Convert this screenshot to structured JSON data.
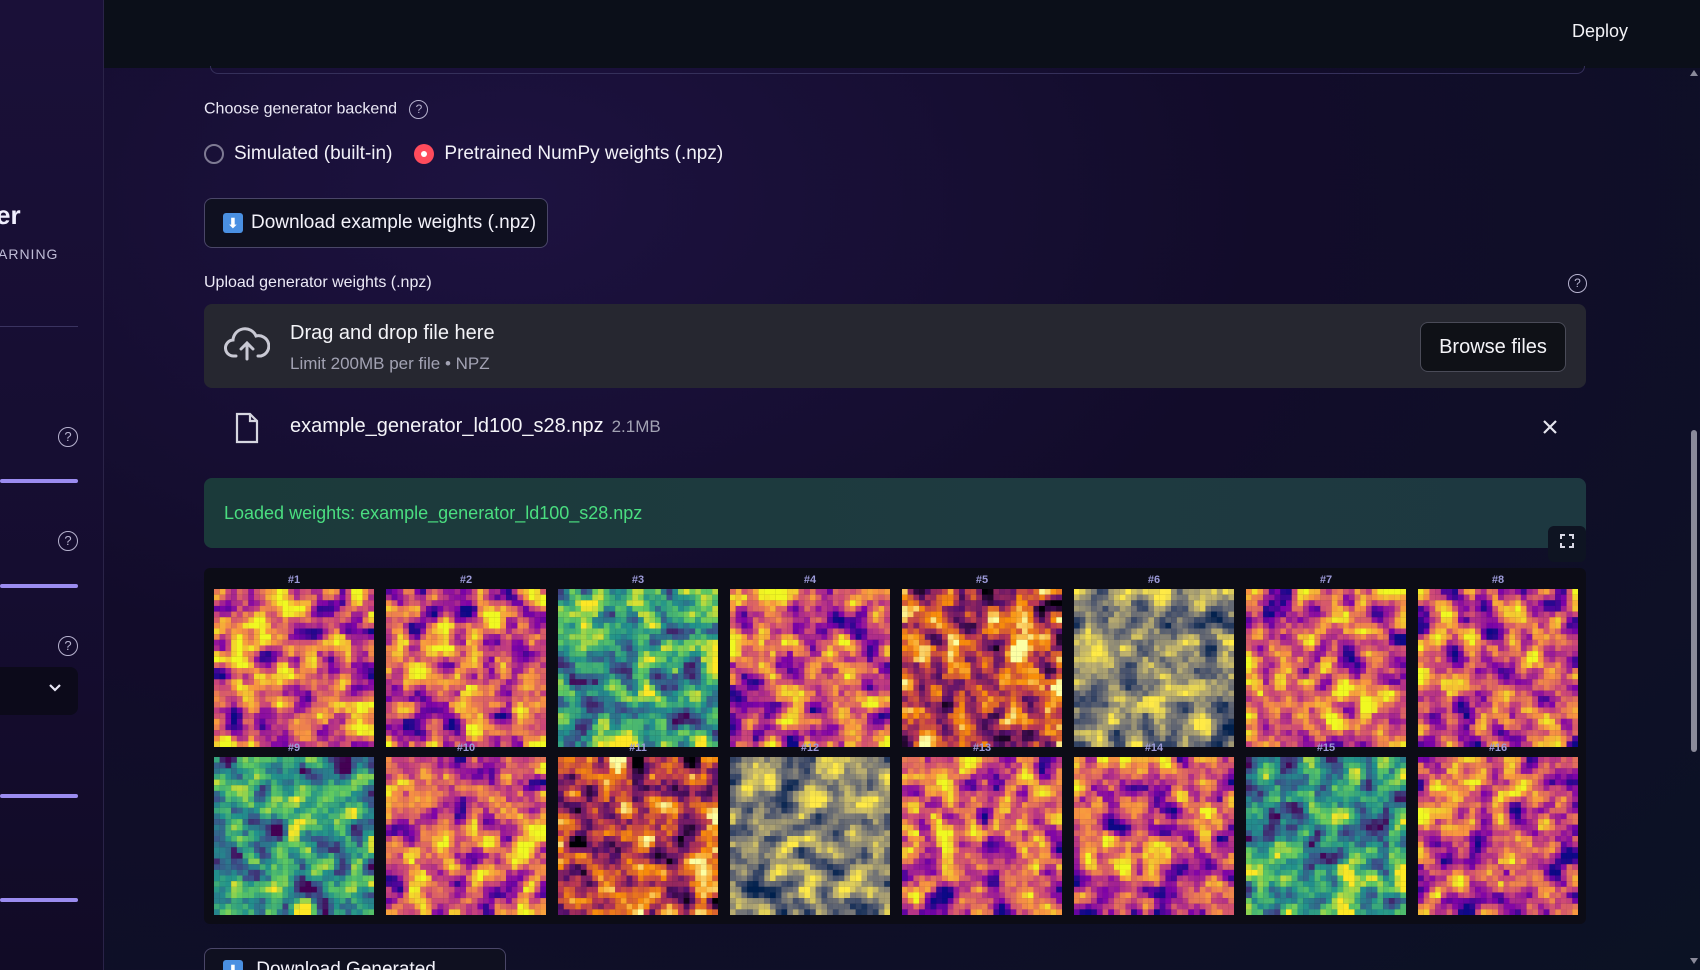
{
  "header": {
    "deploy_label": "Deploy"
  },
  "sidebar": {
    "title_fragment": "er",
    "subtitle_fragment": "ARNING",
    "select_icon": "chevron-down-icon"
  },
  "backend": {
    "label": "Choose generator backend",
    "options": [
      {
        "label": "Simulated (built-in)",
        "selected": false
      },
      {
        "label": "Pretrained NumPy weights (.npz)",
        "selected": true
      }
    ]
  },
  "download_example": {
    "label": "Download example weights (.npz)",
    "icon": "download-icon"
  },
  "upload": {
    "label": "Upload generator weights (.npz)",
    "drop_title": "Drag and drop file here",
    "drop_subtitle": "Limit 200MB per file • NPZ",
    "browse_label": "Browse files",
    "file_name": "example_generator_ld100_s28.npz",
    "file_size": "2.1MB"
  },
  "status": {
    "message": "Loaded weights: example_generator_ld100_s28.npz"
  },
  "samples": {
    "labels": [
      "#1",
      "#2",
      "#3",
      "#4",
      "#5",
      "#6",
      "#7",
      "#8",
      "#9",
      "#10",
      "#11",
      "#12",
      "#13",
      "#14",
      "#15",
      "#16"
    ],
    "colormaps": [
      "plasma",
      "plasma",
      "viridis",
      "plasma",
      "inferno",
      "cividis",
      "plasma",
      "plasma",
      "viridis",
      "plasma",
      "inferno",
      "cividis",
      "plasma",
      "plasma",
      "viridis",
      "plasma"
    ]
  },
  "bottom_button": {
    "label": "Download Generated Images",
    "icon": "download-icon"
  },
  "colors": {
    "accent": "#ff4b5c",
    "success_text": "#4ade80",
    "slider": "#9b8cf0"
  }
}
